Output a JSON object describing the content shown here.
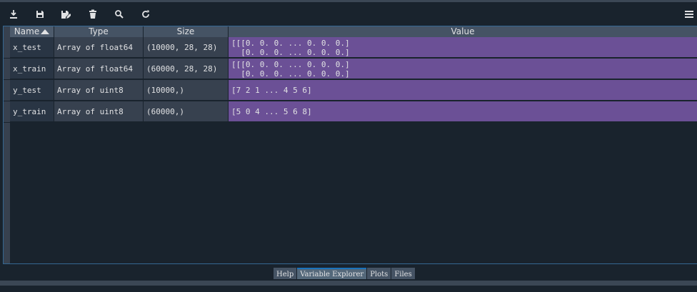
{
  "toolbar": {
    "buttons": [
      "import-data",
      "save-data",
      "save-data-as",
      "remove-all-variables",
      "search",
      "refresh"
    ],
    "menu": "options-menu"
  },
  "table": {
    "columns": [
      "Name",
      "Type",
      "Size",
      "Value"
    ],
    "sort": {
      "column": "Name",
      "direction": "ascending"
    },
    "rows": [
      {
        "name": "x_test",
        "type": "Array of float64",
        "size": "(10000, 28, 28)",
        "value": "[[[0. 0. 0. ... 0. 0. 0.]\n  [0. 0. 0. ... 0. 0. 0.]"
      },
      {
        "name": "x_train",
        "type": "Array of float64",
        "size": "(60000, 28, 28)",
        "value": "[[[0. 0. 0. ... 0. 0. 0.]\n  [0. 0. 0. ... 0. 0. 0.]"
      },
      {
        "name": "y_test",
        "type": "Array of uint8",
        "size": "(10000,)",
        "value": "[7 2 1 ... 4 5 6]"
      },
      {
        "name": "y_train",
        "type": "Array of uint8",
        "size": "(60000,)",
        "value": "[5 0 4 ... 5 6 8]"
      }
    ]
  },
  "tabs": [
    {
      "label": "Help",
      "active": false
    },
    {
      "label": "Variable Explorer",
      "active": true
    },
    {
      "label": "Plots",
      "active": false
    },
    {
      "label": "Files",
      "active": false
    }
  ],
  "colors": {
    "background": "#19232d",
    "header": "#455364",
    "value_cell": "#6b5096",
    "accent": "#1a72bb"
  }
}
